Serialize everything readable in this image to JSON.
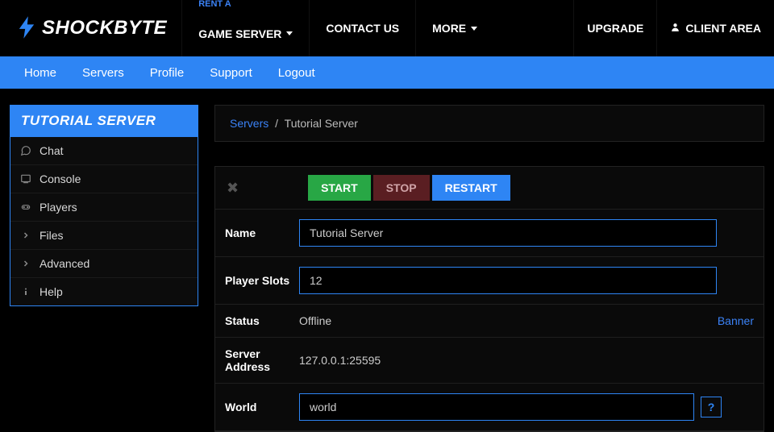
{
  "brand": {
    "name": "SHOCKBYTE"
  },
  "topnav": {
    "rent_sub": "RENT A",
    "rent_main": "GAME SERVER",
    "contact": "CONTACT US",
    "more": "MORE",
    "upgrade": "UPGRADE",
    "client_area": "CLIENT AREA"
  },
  "subnav": {
    "home": "Home",
    "servers": "Servers",
    "profile": "Profile",
    "support": "Support",
    "logout": "Logout"
  },
  "sidebar": {
    "title": "TUTORIAL SERVER",
    "items": [
      {
        "label": "Chat"
      },
      {
        "label": "Console"
      },
      {
        "label": "Players"
      },
      {
        "label": "Files"
      },
      {
        "label": "Advanced"
      },
      {
        "label": "Help"
      }
    ]
  },
  "breadcrumb": {
    "root": "Servers",
    "sep": "/",
    "current": "Tutorial Server"
  },
  "controls": {
    "start": "START",
    "stop": "STOP",
    "restart": "RESTART"
  },
  "form": {
    "name_label": "Name",
    "name_value": "Tutorial Server",
    "slots_label": "Player Slots",
    "slots_value": "12",
    "status_label": "Status",
    "status_value": "Offline",
    "banner_link": "Banner",
    "address_label": "Server Address",
    "address_value": "127.0.0.1:25595",
    "world_label": "World",
    "world_value": "world",
    "help": "?"
  }
}
